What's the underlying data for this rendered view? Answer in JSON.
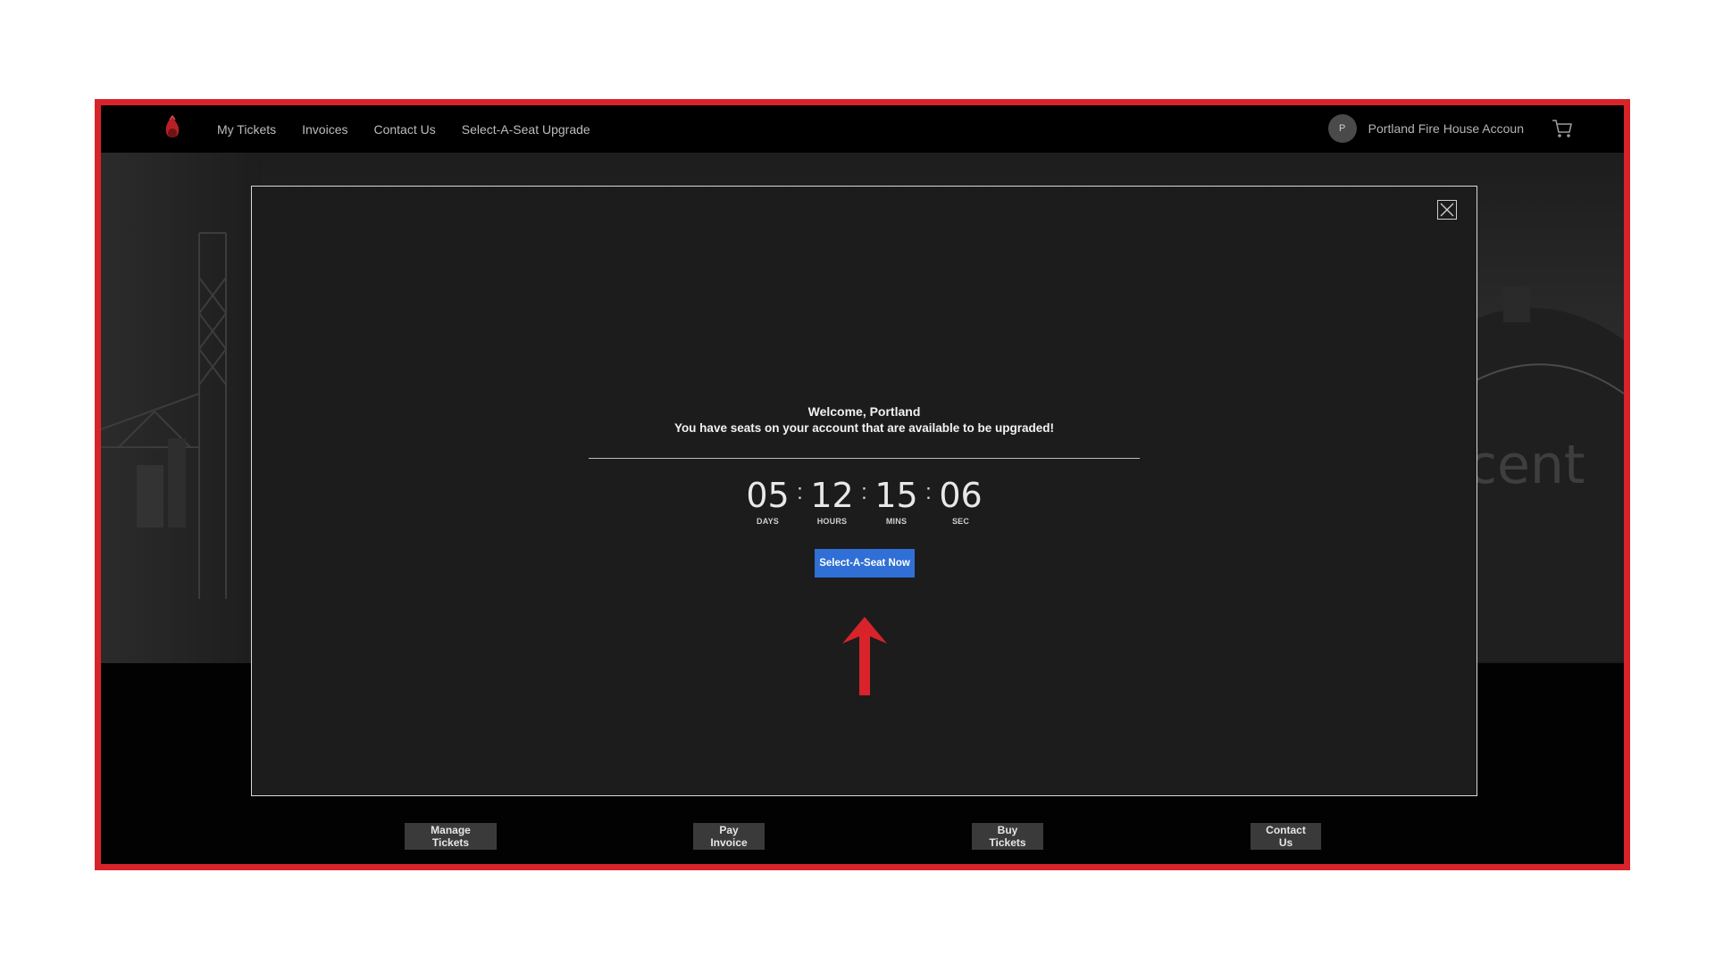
{
  "navbar": {
    "links": [
      "My Tickets",
      "Invoices",
      "Contact Us",
      "Select-A-Seat Upgrade"
    ],
    "avatar_initial": "P",
    "account_name": "Portland Fire House Accoun"
  },
  "modal": {
    "welcome": "Welcome, Portland",
    "message": "You have seats on your account that are available to be upgraded!",
    "countdown": {
      "days": "05",
      "days_label": "DAYS",
      "hours": "12",
      "hours_label": "HOURS",
      "mins": "15",
      "mins_label": "MINS",
      "sec": "06",
      "sec_label": "SEC",
      "separator": ":"
    },
    "cta_label": "Select-A-Seat Now"
  },
  "actions": {
    "manage": "Manage Tickets",
    "pay": "Pay Invoice",
    "buy": "Buy Tickets",
    "contact": "Contact Us"
  },
  "colors": {
    "frame_border": "#d8232a",
    "cta_blue": "#2f6fd6",
    "arrow_red": "#d8232a"
  },
  "icons": {
    "logo": "flame-logo-icon",
    "cart": "shopping-cart-icon",
    "close": "close-icon",
    "arrow": "arrow-up-icon"
  }
}
